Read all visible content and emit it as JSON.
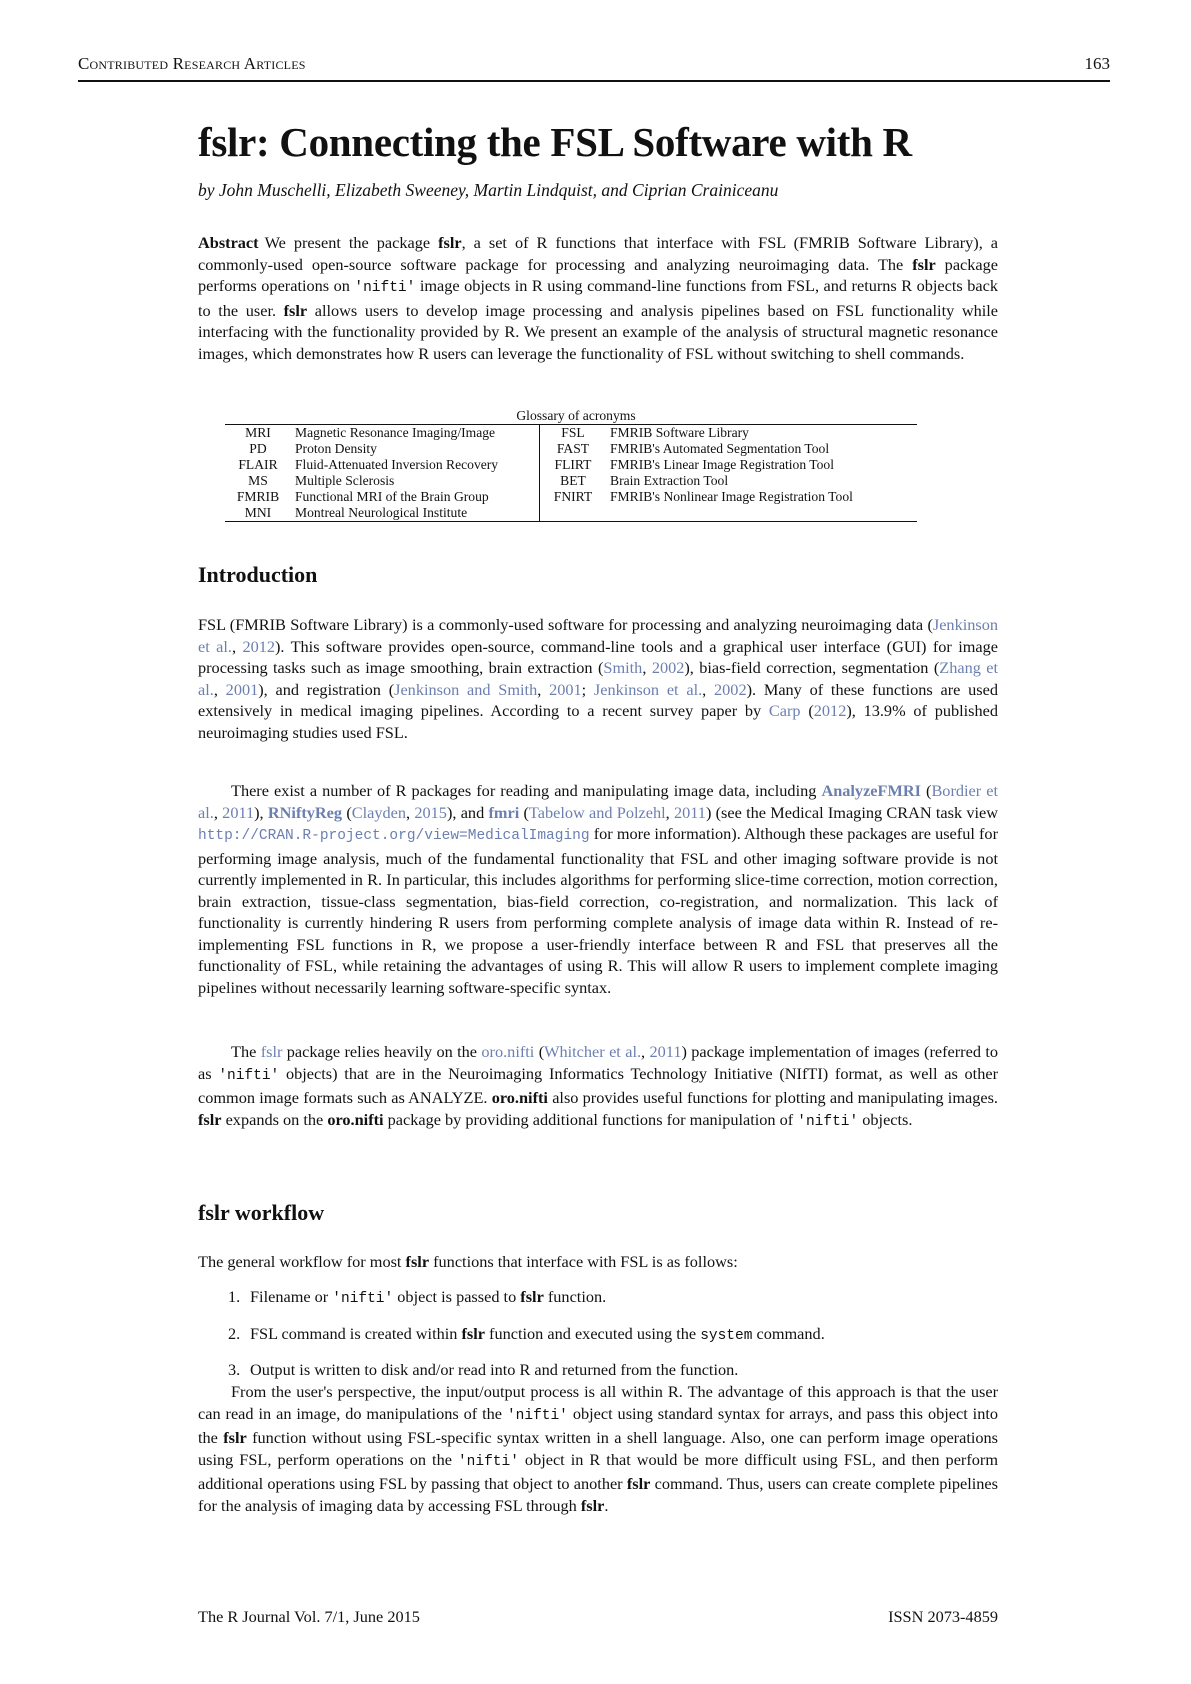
{
  "header": {
    "running_title": "Contributed Research Articles",
    "page_number": "163"
  },
  "title": "fslr: Connecting the FSL Software with R",
  "authors": "by John Muschelli, Elizabeth Sweeney, Martin Lindquist, and Ciprian Crainiceanu",
  "abstract": {
    "label": "Abstract",
    "parts": [
      "We present the package ",
      "fslr",
      ", a set of R functions that interface with FSL (FMRIB Software Library), a commonly-used open-source software package for processing and analyzing neuroimaging data.  The ",
      "fslr",
      " package performs operations on ",
      "'nifti'",
      " image objects in R using command-line functions from FSL, and returns R objects back to the user.  ",
      "fslr",
      " allows users to develop image processing and analysis pipelines based on FSL functionality while interfacing with the functionality provided by R. We present an example of the analysis of structural magnetic resonance images, which demonstrates how R users can leverage the functionality of FSL without switching to shell commands."
    ]
  },
  "glossary": {
    "caption": "Glossary of acronyms",
    "rows": [
      {
        "a1": "MRI",
        "d1": "Magnetic Resonance Imaging/Image",
        "a2": "FSL",
        "d2": "FMRIB Software Library"
      },
      {
        "a1": "PD",
        "d1": "Proton Density",
        "a2": "FAST",
        "d2": "FMRIB's Automated Segmentation Tool"
      },
      {
        "a1": "FLAIR",
        "d1": "Fluid-Attenuated Inversion Recovery",
        "a2": "FLIRT",
        "d2": "FMRIB's Linear Image Registration Tool"
      },
      {
        "a1": "MS",
        "d1": "Multiple Sclerosis",
        "a2": "BET",
        "d2": "Brain Extraction Tool"
      },
      {
        "a1": "FMRIB",
        "d1": "Functional MRI of the Brain Group",
        "a2": "FNIRT",
        "d2": "FMRIB's Nonlinear Image Registration Tool"
      },
      {
        "a1": "MNI",
        "d1": "Montreal Neurological Institute",
        "a2": "",
        "d2": ""
      }
    ]
  },
  "introduction": {
    "heading": "Introduction",
    "p1": {
      "t1": "FSL (FMRIB Software Library) is a commonly-used software for processing and analyzing neuroimaging data (",
      "c1": "Jenkinson et al.",
      "s1": ", ",
      "c1y": "2012",
      "t2": ").  This software provides open-source, command-line tools and a graphical user interface (GUI) for image processing tasks such as image smoothing, brain extraction (",
      "c2": "Smith",
      "s2": ", ",
      "c2y": "2002",
      "t3": "), bias-field correction, segmentation (",
      "c3": "Zhang et al.",
      "s3": ", ",
      "c3y": "2001",
      "t4": "), and registration (",
      "c4": "Jenkinson and Smith",
      "s4": ", ",
      "c4y": "2001",
      "s5": "; ",
      "c5": "Jenkinson et al.",
      "s6": ", ",
      "c5y": "2002",
      "t5": "). Many of these functions are used extensively in medical imaging pipelines.  According to a recent survey paper by ",
      "c6": "Carp",
      "s7": " (",
      "c6y": "2012",
      "t6": "), 13.9% of published neuroimaging studies used FSL."
    },
    "p2": {
      "t1": "There exist a number of R packages for reading and manipulating image data, including ",
      "pk1": "AnalyzeFMRI",
      "s1": " (",
      "c1": "Bordier et al.",
      "s2": ", ",
      "c1y": "2011",
      "s3": "), ",
      "pk2": "RNiftyReg",
      "s4": " (",
      "c2": "Clayden",
      "s5": ", ",
      "c2y": "2015",
      "s6": "), and ",
      "pk3": "fmri",
      "s7": " (",
      "c3": "Tabelow and Polzehl",
      "s8": ", ",
      "c3y": "2011",
      "t2": ") (see the Medical Imaging CRAN task view ",
      "url": "http://CRAN.R-project.org/view=MedicalImaging",
      "t3": " for more information). Although these packages are useful for performing image analysis, much of the fundamental functionality that FSL and other imaging software provide is not currently implemented in R. In particular, this includes algorithms for performing slice-time correction, motion correction, brain extraction, tissue-class segmentation, bias-field correction, co-registration, and normalization. This lack of functionality is currently hindering R users from performing complete analysis of image data within R. Instead of re-implementing FSL functions in R, we propose a user-friendly interface between R and FSL that preserves all the functionality of FSL, while retaining the advantages of using R. This will allow R users to implement complete imaging pipelines without necessarily learning software-specific syntax."
    },
    "p3": {
      "t1": "The ",
      "pk1": "fslr",
      "t2": " package relies heavily on the ",
      "pk2": "oro.nifti",
      "s1": " (",
      "c1": "Whitcher et al.",
      "s2": ", ",
      "c1y": "2011",
      "t3": ") package implementation of images (referred to as ",
      "m1": "'nifti'",
      "t4": " objects) that are in the Neuroimaging Informatics Technology Initiative (NIfTI) format, as well as other common image formats such as ANALYZE. ",
      "b1": "oro.nifti",
      "t5": " also provides useful functions for plotting and manipulating images.  ",
      "b2": "fslr",
      "t6": " expands on the ",
      "b3": "oro.nifti",
      "t7": " package by providing additional functions for manipulation of ",
      "m2": "'nifti'",
      "t8": " objects."
    }
  },
  "workflow": {
    "heading": "fslr workflow",
    "intro": {
      "t1": "The general workflow for most ",
      "b1": "fslr",
      "t2": " functions that interface with FSL is as follows:"
    },
    "steps": [
      {
        "num": "1.",
        "t1": "Filename or ",
        "m1": "'nifti'",
        "t2": " object is passed to ",
        "b1": "fslr",
        "t3": " function.",
        "t4": ""
      },
      {
        "num": "2.",
        "t1": "FSL command is created within ",
        "b1": "fslr",
        "t2": " function and executed using the ",
        "m1": "system",
        "t3": " command.",
        "t4": ""
      },
      {
        "num": "3.",
        "t1": "Output is written to disk and/or read into R and returned from the function.",
        "b1": "",
        "t2": "",
        "m1": "",
        "t3": "",
        "t4": ""
      }
    ],
    "p2": {
      "t1": "From the user's perspective, the input/output process is all within R. The advantage of this approach is that the user can read in an image, do manipulations of the ",
      "m1": "'nifti'",
      "t2": " object using standard syntax for arrays, and pass this object into the ",
      "b1": "fslr",
      "t3": " function without using FSL-specific syntax written in a shell language. Also, one can perform image operations using FSL, perform operations on the ",
      "m2": "'nifti'",
      "t4": " object in R that would be more difficult using FSL, and then perform additional operations using FSL by passing that object to another ",
      "b2": "fslr",
      "t5": " command. Thus, users can create complete pipelines for the analysis of imaging data by accessing FSL through ",
      "b3": "fslr",
      "t6": "."
    }
  },
  "footer": {
    "journal": "The R Journal Vol. 7/1, June 2015",
    "issn": "ISSN 2073-4859"
  },
  "colors": {
    "link": "#6b7fb0",
    "text": "#111111"
  }
}
